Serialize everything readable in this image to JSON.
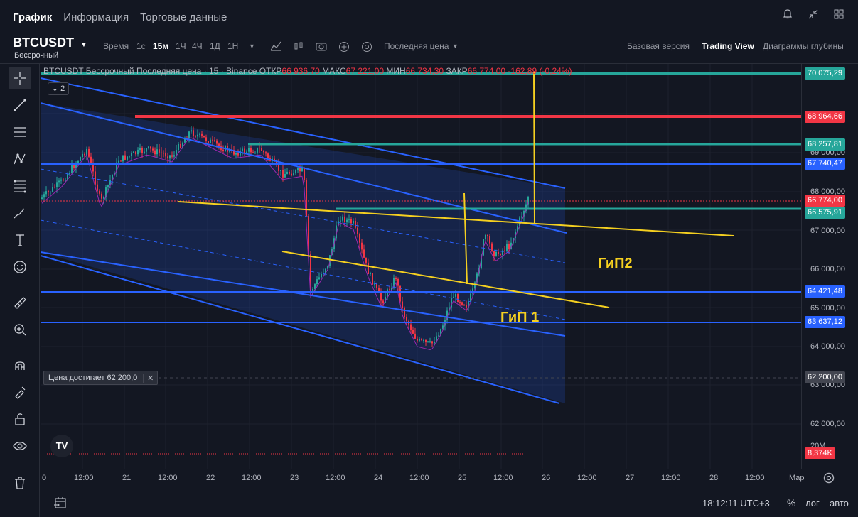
{
  "tabs": [
    {
      "label": "График",
      "active": true
    },
    {
      "label": "Информация",
      "active": false
    },
    {
      "label": "Торговые данные",
      "active": false
    }
  ],
  "symbol": {
    "name": "BTCUSDT",
    "type": "Бессрочный"
  },
  "toolbar": {
    "time_label": "Время",
    "intervals": [
      {
        "label": "1с",
        "active": false
      },
      {
        "label": "15м",
        "active": true
      },
      {
        "label": "1Ч",
        "active": false
      },
      {
        "label": "4Ч",
        "active": false
      },
      {
        "label": "1Д",
        "active": false
      },
      {
        "label": "1Н",
        "active": false
      }
    ],
    "price_mode": "Последняя цена",
    "views": [
      {
        "label": "Базовая версия",
        "active": false
      },
      {
        "label": "Trading View",
        "active": true
      },
      {
        "label": "Диаграммы глубины",
        "active": false
      }
    ]
  },
  "legend": {
    "title": "BTCUSDT Бессрочный Последняя цена · 15 · Binance",
    "open_label": "ОТКР",
    "open": "66 936,70",
    "high_label": "МАКС",
    "high": "67 221,00",
    "low_label": "МИН",
    "low": "66 734,30",
    "close_label": "ЗАКР",
    "close": "66 774,00",
    "change": "-162,89 (-0,24%)"
  },
  "collapse_count": "2",
  "alert": {
    "text": "Цена достигает 62 200,0",
    "close": "✕"
  },
  "annotations": {
    "gip1": "ГиП 1",
    "gip2": "ГиП2"
  },
  "price_axis": {
    "ticks": [
      "69 000,00",
      "68 000,00",
      "67 000,00",
      "66 000,00",
      "65 000,00",
      "64 000,00",
      "63 000,00",
      "62 000,00"
    ],
    "volume_tick": "20M",
    "tags": [
      {
        "label": "70 075,29",
        "color": "#26a69a"
      },
      {
        "label": "68 964,66",
        "color": "#f23645"
      },
      {
        "label": "68 257,81",
        "color": "#26a69a"
      },
      {
        "label": "67 740,47",
        "color": "#2962ff"
      },
      {
        "label": "66 774,00",
        "color": "#f23645"
      },
      {
        "label": "66 575,91",
        "color": "#26a69a"
      },
      {
        "label": "64 421,48",
        "color": "#2962ff"
      },
      {
        "label": "63 637,12",
        "color": "#2962ff"
      },
      {
        "label": "62 200,00",
        "color": "#434651"
      },
      {
        "label": "8,374K",
        "color": "#f23645"
      }
    ]
  },
  "time_axis": [
    "0",
    "12:00",
    "21",
    "12:00",
    "22",
    "12:00",
    "23",
    "12:00",
    "24",
    "12:00",
    "25",
    "12:00",
    "26",
    "12:00",
    "27",
    "12:00",
    "28",
    "12:00",
    "Мар"
  ],
  "bottom": {
    "clock": "18:12:11 UTC+3",
    "percent": "%",
    "log": "лог",
    "auto": "авто"
  },
  "colors": {
    "bg": "#131722",
    "up": "#26a69a",
    "down": "#f23645",
    "channel": "#2962ff",
    "trend": "#f5d020",
    "ma": "#9c27b0"
  }
}
